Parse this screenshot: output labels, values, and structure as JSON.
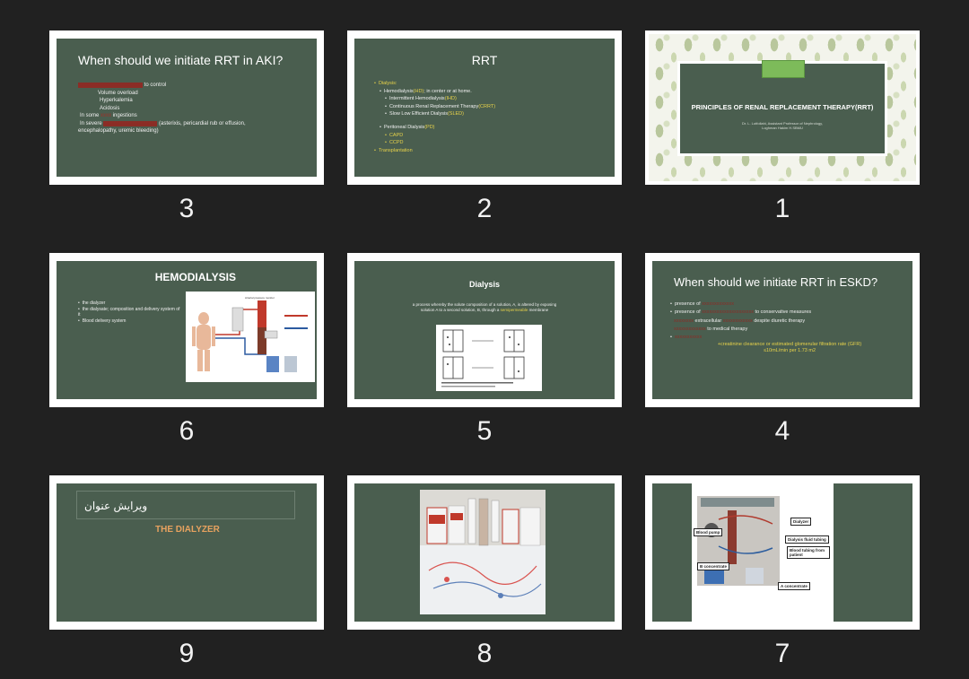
{
  "slides": [
    {
      "number": "1",
      "title": "PRINCIPLES OF RENAL REPLACEMENT THERAPY(RRT)",
      "subtitle_line1": "Dr. L. Lotfollahi, Assistant Professor of Nephrology,",
      "subtitle_line2": "Loghman Hakim H.SBMU"
    },
    {
      "number": "2",
      "title": "RRT",
      "dialysis": "Dialysis:",
      "hd_a": "Hemodialysis",
      "hd_b": "(HD)",
      "hd_c": "; in center or at home.",
      "ihd_a": "Intermittent Hemodialysis",
      "ihd_b": "(IHD)",
      "crrt_a": "Continuous Renal Replacement Therapy",
      "crrt_b": "(CRRT)",
      "sled_a": "Slow Low Efficient Dialysis",
      "sled_b": "(SLED)",
      "pd_a": "Peritoneal Dialysis",
      "pd_b": "(PD)",
      "capd": "CAPD",
      "ccpd": "CCPD",
      "transplant": "Transplantation"
    },
    {
      "number": "3",
      "title": "When should we initiate RRT in AKI?",
      "line1_b": "to control",
      "line2": "Volume overload",
      "line3": "Hyperkalemia",
      "line4": "Acidosis",
      "line5_a": "In some",
      "line5_c": "ingestions",
      "line6_a": "In severe",
      "line6_c": "(asterixis, pericardial rub or effusion,",
      "line7": "encephalopathy, uremic bleeding)"
    },
    {
      "number": "4",
      "title": "When should we initiate RRT in ESKD?",
      "b1_a": "presence of",
      "b2_a": "presence of",
      "b2_c": "to conservative measures",
      "b3_b": "extracellular",
      "b3_d": "despite diuretic therapy",
      "b4_b": "to medical therapy",
      "crcl_line1": "+creatinine clearance or estimated glomerular filtration rate (GFR)",
      "crcl_line2": "≤10mL/min per 1.73 m2"
    },
    {
      "number": "5",
      "title": "Dialysis",
      "text_a": "a process whereby the solute composition of a solution, A, is altered by exposing",
      "text_b": "solution A to a second solution, B, through a",
      "text_c": "semipermeable",
      "text_d": "membrane"
    },
    {
      "number": "6",
      "title": "HEMODIALYSIS",
      "b1": "the dialyzer",
      "b2": "the dialysate; composition and delivery system of it",
      "b3": "Blood delivery system"
    },
    {
      "number": "7",
      "labels": [
        "Dialyzer",
        "Blood pump",
        "Dialysis fluid tubing",
        "Blood tubing from patient",
        "B concentrate",
        "A concentrate"
      ]
    },
    {
      "number": "8"
    },
    {
      "number": "9",
      "title_placeholder": "ویرایش عنوان",
      "heading": "THE DIALYZER"
    }
  ]
}
